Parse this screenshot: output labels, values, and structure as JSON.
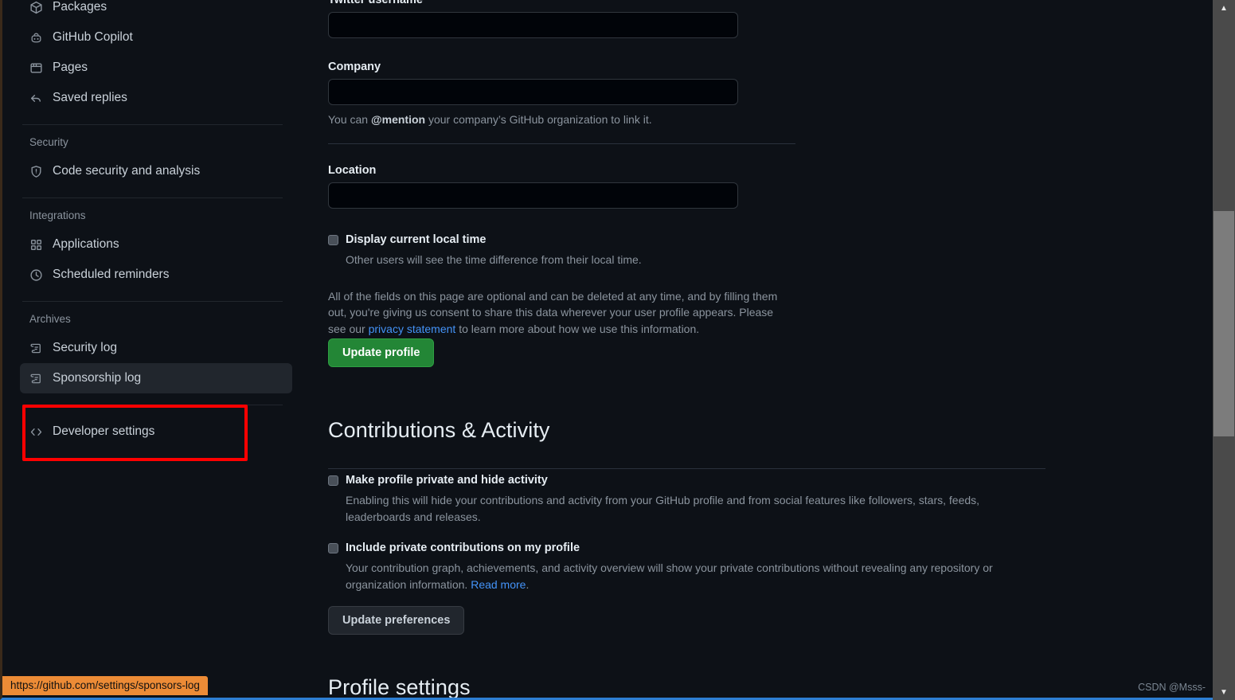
{
  "sidebar": {
    "top_items": [
      {
        "label": "Packages",
        "icon": "package-icon",
        "name": "sidebar-item-packages"
      },
      {
        "label": "GitHub Copilot",
        "icon": "copilot-icon",
        "name": "sidebar-item-github-copilot"
      },
      {
        "label": "Pages",
        "icon": "browser-window-icon",
        "name": "sidebar-item-pages"
      },
      {
        "label": "Saved replies",
        "icon": "reply-arrow-icon",
        "name": "sidebar-item-saved-replies"
      }
    ],
    "security_heading": "Security",
    "security_items": [
      {
        "label": "Code security and analysis",
        "icon": "shield-icon",
        "name": "sidebar-item-code-security-and-analysis"
      }
    ],
    "integrations_heading": "Integrations",
    "integrations_items": [
      {
        "label": "Applications",
        "icon": "apps-grid-icon",
        "name": "sidebar-item-applications"
      },
      {
        "label": "Scheduled reminders",
        "icon": "clock-icon",
        "name": "sidebar-item-scheduled-reminders"
      }
    ],
    "archives_heading": "Archives",
    "archives_items": [
      {
        "label": "Security log",
        "icon": "log-scroll-icon",
        "name": "sidebar-item-security-log",
        "hovered": false
      },
      {
        "label": "Sponsorship log",
        "icon": "log-scroll-icon",
        "name": "sidebar-item-sponsorship-log",
        "hovered": true
      }
    ],
    "developer_item": {
      "label": "Developer settings",
      "icon": "code-brackets-icon",
      "name": "sidebar-item-developer-settings"
    }
  },
  "profile_form": {
    "twitter_label": "Twitter username",
    "twitter_value": "",
    "twitter_placeholder": "",
    "company_label": "Company",
    "company_value": "",
    "company_placeholder": "",
    "company_note_prefix": "You can ",
    "company_note_mention": "@mention",
    "company_note_suffix": " your company’s GitHub organization to link it.",
    "location_label": "Location",
    "location_value": "",
    "location_placeholder": "",
    "local_time_title": "Display current local time",
    "local_time_desc": "Other users will see the time difference from their local time.",
    "consent_text_1": "All of the fields on this page are optional and can be deleted at any time, and by filling them out, you're giving us consent to share this data wherever your user profile appears. Please see our ",
    "consent_link": "privacy statement",
    "consent_text_2": " to learn more about how we use this information.",
    "update_profile_label": "Update profile"
  },
  "contributions": {
    "heading": "Contributions & Activity",
    "items": [
      {
        "title": "Make profile private and hide activity",
        "desc": "Enabling this will hide your contributions and activity from your GitHub profile and from social features like followers, stars, feeds, leaderboards and releases.",
        "name": "checkbox-make-profile-private"
      },
      {
        "title": "Include private contributions on my profile",
        "desc": "Your contribution graph, achievements, and activity overview will show your private contributions without revealing any repository or organization information. ",
        "link": "Read more",
        "desc_tail": ".",
        "name": "checkbox-include-private-contributions"
      }
    ],
    "update_preferences_label": "Update preferences"
  },
  "profile_settings": {
    "heading": "Profile settings"
  },
  "status_bar": {
    "url": "https://github.com/settings/sponsors-log"
  },
  "watermark": {
    "text": "CSDN @Msss-"
  },
  "scrollbar": {
    "up_arrow": "▲",
    "down_arrow": "▼"
  },
  "colors": {
    "page_bg": "#0d1117",
    "input_bg": "#010409",
    "accent_green": "#238636",
    "link_blue": "#4493f8",
    "annotation_red": "#ff0000",
    "status_orange": "#ec8b36"
  }
}
